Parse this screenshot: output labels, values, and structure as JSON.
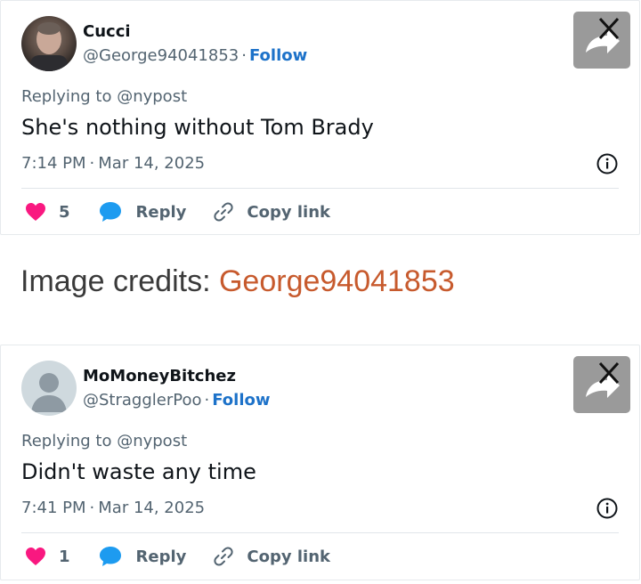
{
  "tweets": [
    {
      "name": "Cucci",
      "handle": "@George94041853",
      "separator": "·",
      "follow": "Follow",
      "reply_to": "Replying to @nypost",
      "text": "She's nothing without Tom Brady",
      "time": "7:14 PM",
      "date": "Mar 14, 2025",
      "likes": "5",
      "reply": "Reply",
      "copy_link": "Copy link",
      "avatar": "profile-photo"
    },
    {
      "name": "MoMoneyBitchez",
      "handle": "@StragglerPoo",
      "separator": "·",
      "follow": "Follow",
      "reply_to": "Replying to @nypost",
      "text": "Didn't waste any time",
      "time": "7:41 PM",
      "date": "Mar 14, 2025",
      "likes": "1",
      "reply": "Reply",
      "copy_link": "Copy link",
      "avatar": "default-avatar"
    }
  ],
  "credits": {
    "label": "Image credits:",
    "user": "George94041853"
  },
  "colors": {
    "heart": "#f91880",
    "reply_bubble": "#1d9bf0",
    "follow": "#1d72c9",
    "credit_user": "#c75a2d"
  },
  "icons": [
    "heart-icon",
    "reply-bubble-icon",
    "link-icon",
    "info-icon",
    "share-arrow-icon",
    "x-logo-icon"
  ]
}
